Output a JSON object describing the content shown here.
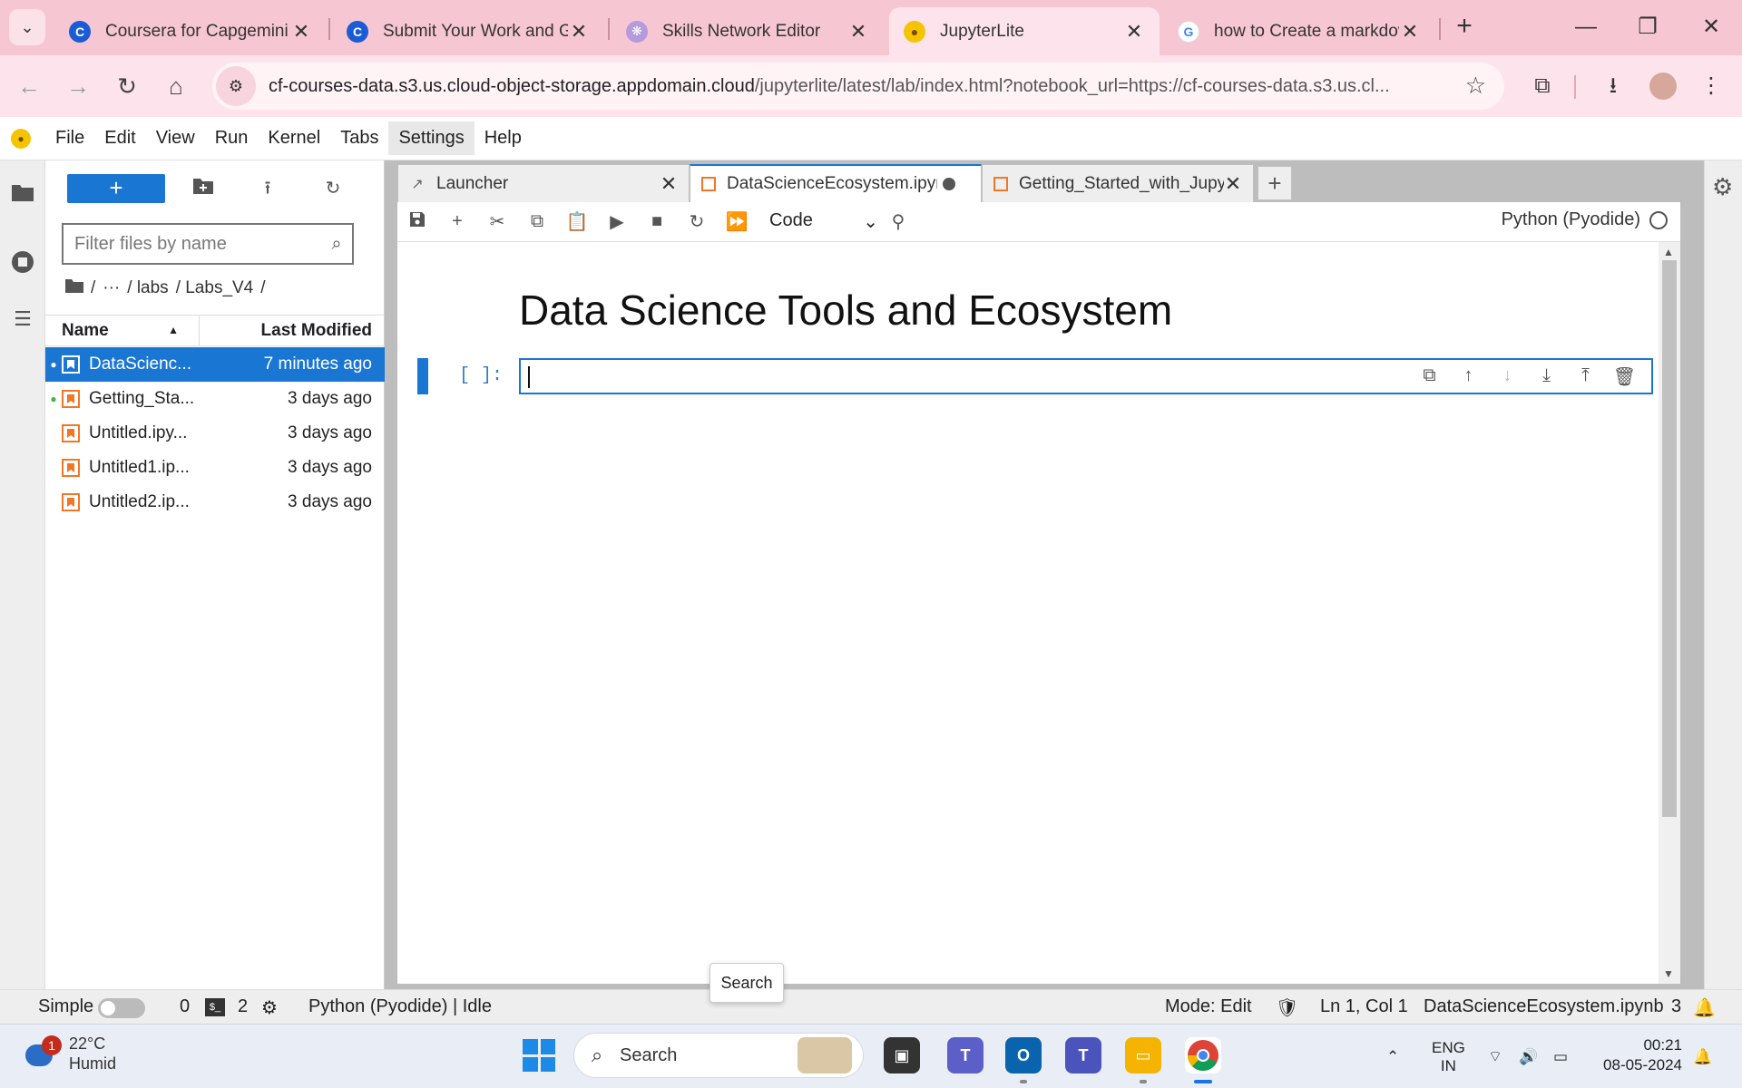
{
  "browser": {
    "tabs": [
      {
        "title": "Coursera for Capgemini |",
        "favicon": "coursera-icon",
        "active": false
      },
      {
        "title": "Submit Your Work and Gr",
        "favicon": "coursera-icon",
        "active": false
      },
      {
        "title": "Skills Network Editor",
        "favicon": "skills-network-icon",
        "active": false
      },
      {
        "title": "JupyterLite",
        "favicon": "jupyterlite-icon",
        "active": true
      },
      {
        "title": "how to Create a markdov",
        "favicon": "google-icon",
        "active": false
      }
    ],
    "new_tab": "+",
    "url_host": "cf-courses-data.s3.us.cloud-object-storage.appdomain.cloud",
    "url_path": "/jupyterlite/latest/lab/index.html?notebook_url=https://cf-courses-data.s3.us.cl..."
  },
  "menubar": {
    "items": [
      "File",
      "Edit",
      "View",
      "Run",
      "Kernel",
      "Tabs",
      "Settings",
      "Help"
    ],
    "hovered": "Settings"
  },
  "filebrowser": {
    "new_label": "+",
    "filter_placeholder": "Filter files by name",
    "breadcrumbs": [
      "/",
      "···",
      "/ labs",
      "/ Labs_V4",
      "/"
    ],
    "col_name": "Name",
    "col_modified": "Last Modified",
    "files": [
      {
        "name": "DataScienc...",
        "modified": "7 minutes ago",
        "selected": true,
        "running": true
      },
      {
        "name": "Getting_Sta...",
        "modified": "3 days ago",
        "selected": false,
        "running": true
      },
      {
        "name": "Untitled.ipy...",
        "modified": "3 days ago",
        "selected": false,
        "running": false
      },
      {
        "name": "Untitled1.ip...",
        "modified": "3 days ago",
        "selected": false,
        "running": false
      },
      {
        "name": "Untitled2.ip...",
        "modified": "3 days ago",
        "selected": false,
        "running": false
      }
    ]
  },
  "doctabs": [
    {
      "title": "Launcher",
      "icon": "launcher-icon"
    },
    {
      "title": "DataScienceEcosystem.ipynb",
      "icon": "notebook-icon",
      "active": true,
      "unsaved": true
    },
    {
      "title": "Getting_Started_with_Jupyter",
      "icon": "notebook-icon"
    }
  ],
  "notebook": {
    "cell_type": "Code",
    "kernel": "Python (Pyodide)",
    "markdown_title": "Data Science Tools and Ecosystem",
    "prompt": "[ ]:"
  },
  "statusbar": {
    "mode_label": "Simple",
    "terminals": "0",
    "kernels": "2",
    "kernel_status": "Python (Pyodide) | Idle",
    "mode": "Mode: Edit",
    "cursor": "Ln 1, Col 1",
    "filename": "DataScienceEcosystem.ipynb",
    "notifications": "3"
  },
  "tooltip": "Search",
  "taskbar": {
    "weather_temp": "22°C",
    "weather_desc": "Humid",
    "weather_badge": "1",
    "search_label": "Search",
    "lang1": "ENG",
    "lang2": "IN",
    "time": "00:21",
    "date": "08-05-2024"
  },
  "colors": {
    "accent": "#1976d2",
    "chrome_tabstrip": "#f6c7d3",
    "notebook_orange": "#f37626"
  }
}
